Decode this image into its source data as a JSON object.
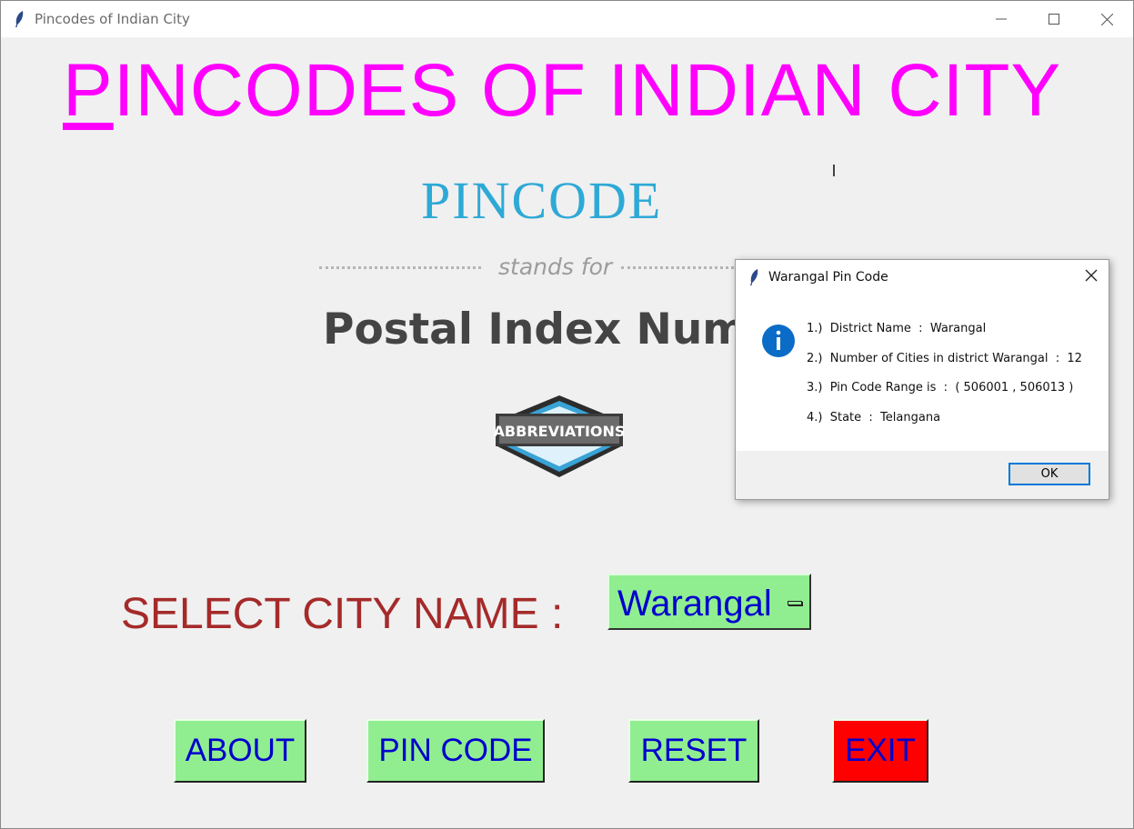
{
  "window": {
    "title": "Pincodes of Indian City"
  },
  "header": {
    "title_first": "P",
    "title_rest": "INCODES OF INDIAN CITY",
    "title_color": "#ff00ff"
  },
  "graphic": {
    "logo_word": "PINCODE",
    "stands_for": "stands for",
    "postal_text": "Postal Index Numb",
    "badge_text": "ABBREVIATIONS"
  },
  "select": {
    "label": "SELECT CITY NAME :",
    "value": "Warangal"
  },
  "buttons": {
    "about": "ABOUT",
    "pincode": "PIN CODE",
    "reset": "RESET",
    "exit": "EXIT"
  },
  "dialog": {
    "title": "Warangal Pin Code",
    "icon": "info-icon",
    "lines": [
      "1.)  District Name  :  Warangal",
      "2.)  Number of Cities in district Warangal  :  12",
      "3.)  Pin Code Range is  :  ( 506001 , 506013 )",
      "4.)  State  :  Telangana"
    ],
    "ok_label": "OK"
  },
  "colors": {
    "button_bg": "#90ee90",
    "button_text": "#0000cd",
    "exit_bg": "#ff0000",
    "label_color": "#a52a2a"
  }
}
